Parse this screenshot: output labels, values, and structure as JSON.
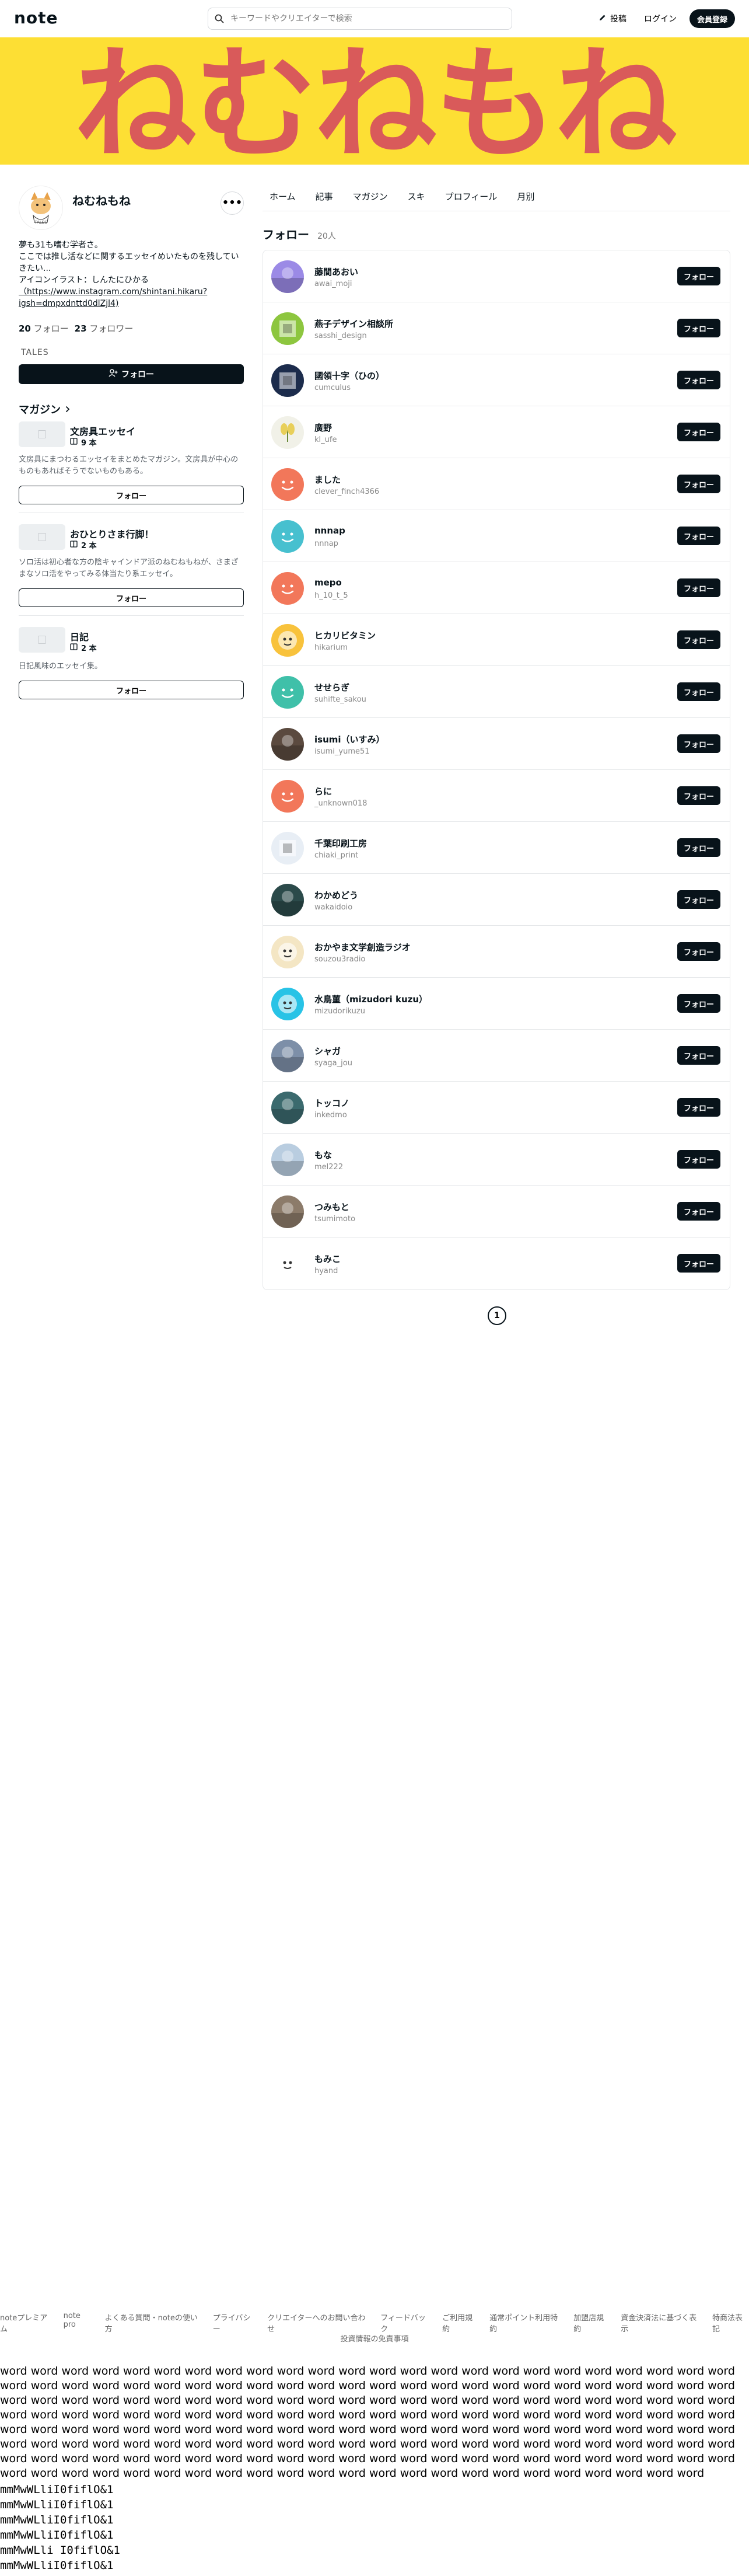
{
  "header": {
    "logo": "note",
    "search_placeholder": "キーワードやクリエイターで検索",
    "post_label": "投稿",
    "login_label": "ログイン",
    "signup_label": "会員登録"
  },
  "banner": {
    "text": "ねむねもね",
    "bg": "#fddf34",
    "fg": "#d95a5a"
  },
  "profile": {
    "name": "ねむねもね",
    "more_label": "•••",
    "bio_lines": [
      "夢も31も嗜む学者さ。",
      "ここでは推し活などに関するエッセイめいたものを残していきたい...",
      "アイコンイラスト：しんたにひかる",
      "（https://www.instagram.com/shintani.hikaru?igsh=dmpxdnttd0dlZjl4)"
    ],
    "following_count": "20",
    "following_label": "フォロー",
    "followers_count": "23",
    "followers_label": "フォロワー",
    "tag": "TALES",
    "follow_label": "フォロー"
  },
  "magazines": {
    "heading": "マガジン",
    "items": [
      {
        "title": "文房具エッセイ",
        "count": "9 本",
        "desc": "文房具にまつわるエッセイをまとめたマガジン。文房具が中心のものもあればそうでないものもある。",
        "follow": "フォロー"
      },
      {
        "title": "おひとりさま行脚！",
        "count": "2 本",
        "desc": "ソロ活は初心者な方の陰キャインドア派のねむねもねが、さまざまなソロ活をやってみる体当たり系エッセイ。",
        "follow": "フォロー"
      },
      {
        "title": "日記",
        "count": "2 本",
        "desc": "日記風味のエッセイ集。",
        "follow": "フォロー"
      }
    ]
  },
  "tabs": [
    "ホーム",
    "記事",
    "マガジン",
    "スキ",
    "プロフィール",
    "月別"
  ],
  "follow_section": {
    "title": "フォロー",
    "count": "20人",
    "button_label": "フォロー"
  },
  "follows": [
    {
      "name": "藤間あおい",
      "id": "awai_moji",
      "color": "#9b8ae6",
      "kind": "circle"
    },
    {
      "name": "燕子デザイン相談所",
      "id": "sasshi_design",
      "color": "#8dc63f",
      "kind": "square"
    },
    {
      "name": "國領十字（ひの）",
      "id": "cumculus",
      "color": "#1c2c4c",
      "kind": "square"
    },
    {
      "name": "廣野",
      "id": "kl_ufe",
      "color": "#f1f1e8",
      "kind": "plant"
    },
    {
      "name": "ました",
      "id": "clever_finch4366",
      "color": "#f2775a",
      "kind": "face"
    },
    {
      "name": "nnnap",
      "id": "nnnap",
      "color": "#47c0cf",
      "kind": "face"
    },
    {
      "name": "mepo",
      "id": "h_10_t_5",
      "color": "#f2775a",
      "kind": "face"
    },
    {
      "name": "ヒカリビタミン",
      "id": "hikarium",
      "color": "#f8c23c",
      "kind": "art"
    },
    {
      "name": "せせらぎ",
      "id": "suhifte_sakou",
      "color": "#3fc0a9",
      "kind": "face"
    },
    {
      "name": "isumi（いすみ）",
      "id": "isumi_yume51",
      "color": "#5b4a3f",
      "kind": "photo"
    },
    {
      "name": "らに",
      "id": "_unknown018",
      "color": "#f2775a",
      "kind": "face"
    },
    {
      "name": "千葉印刷工房",
      "id": "chiaki_print",
      "color": "#e8eef5",
      "kind": "square"
    },
    {
      "name": "わかめどう",
      "id": "wakaidoio",
      "color": "#2b4a4a",
      "kind": "photo"
    },
    {
      "name": "おかやま文学創造ラジオ",
      "id": "souzou3radio",
      "color": "#f4e6c4",
      "kind": "art"
    },
    {
      "name": "水鳥菫（mizudori kuzu）",
      "id": "mizudorikuzu",
      "color": "#28c3e6",
      "kind": "art"
    },
    {
      "name": "シャガ",
      "id": "syaga_jou",
      "color": "#7d8fa8",
      "kind": "photo"
    },
    {
      "name": "トッコノ",
      "id": "inkedmo",
      "color": "#3b6a6e",
      "kind": "photo"
    },
    {
      "name": "もな",
      "id": "mel222",
      "color": "#b9cde0",
      "kind": "photo"
    },
    {
      "name": "つみもと",
      "id": "tsumimoto",
      "color": "#8c7b6a",
      "kind": "photo"
    },
    {
      "name": "もみこ",
      "id": "hyand",
      "color": "#ffffff",
      "kind": "art"
    }
  ],
  "pager": {
    "current": "1"
  },
  "footer": {
    "links": [
      "noteプレミアム",
      "note pro",
      "よくある質問・noteの使い方",
      "プライバシー",
      "クリエイターへのお問い合わせ",
      "フィードバック",
      "ご利用規約",
      "通常ポイント利用特約",
      "加盟店規約",
      "資金決済法に基づく表示",
      "特商法表記"
    ],
    "links2": "投資情報の免責事項"
  },
  "filler": {
    "word": "word",
    "word_count": 191,
    "mono_lines": [
      "mmMwWLliI0fiflO&1",
      "mmMwWLliI0fiflO&1",
      "mmMwWLliI0fiflO&1",
      "mmMwWLliI0fiflO&1",
      "mmMwWLli I0fiflO&1"
    ],
    "mono_last": "mmMwWLliI0fiflO&1"
  }
}
